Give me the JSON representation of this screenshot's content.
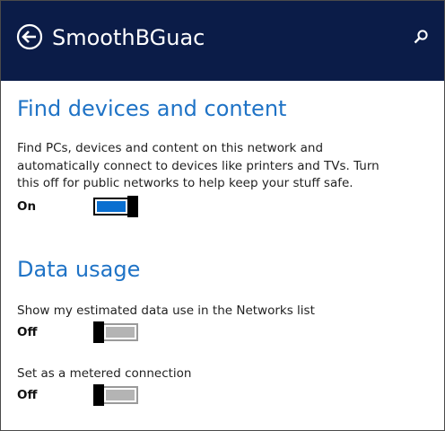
{
  "header": {
    "title": "SmoothBGuac",
    "back_icon": "back-arrow-icon",
    "search_icon": "search-icon",
    "background": "#0b1c48"
  },
  "find_devices": {
    "title": "Find devices and content",
    "description": "Find PCs, devices and content on this network and automatically connect to devices like printers and TVs. Turn this off for public networks to help keep your stuff safe.",
    "state_label": "On",
    "on": true
  },
  "data_usage": {
    "title": "Data usage",
    "estimated": {
      "label": "Show my estimated data use in the Networks list",
      "state_label": "Off",
      "on": false
    },
    "metered": {
      "label": "Set as a metered connection",
      "state_label": "Off",
      "on": false
    }
  },
  "colors": {
    "accent": "#1f73c6",
    "toggle_on": "#0a6fd0",
    "toggle_off": "#b4b4b4"
  }
}
